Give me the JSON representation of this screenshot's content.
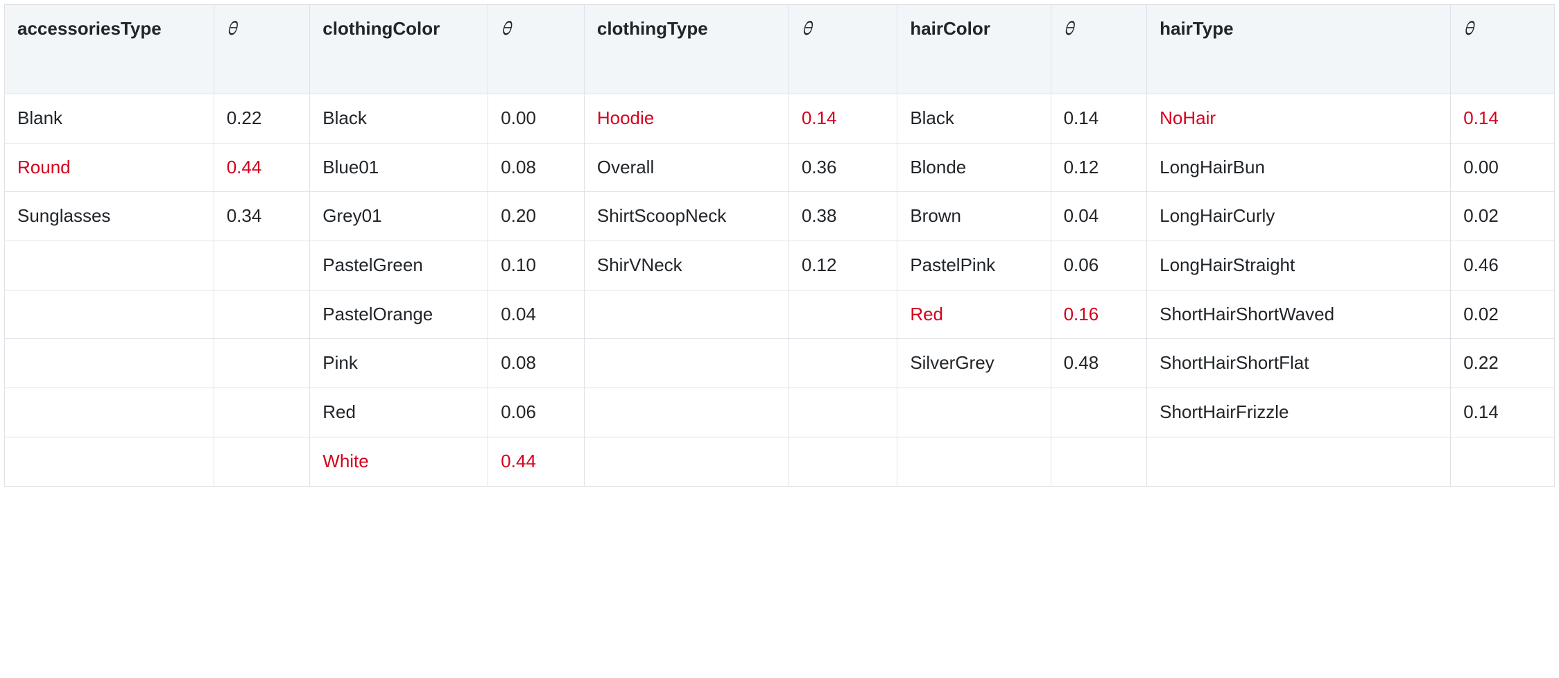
{
  "theta": "θ",
  "headers": [
    "accessoriesType",
    "θ",
    "clothingColor",
    "θ",
    "clothingType",
    "θ",
    "hairColor",
    "θ",
    "hairType",
    "θ"
  ],
  "headerIsTheta": [
    false,
    true,
    false,
    true,
    false,
    true,
    false,
    true,
    false,
    true
  ],
  "rows": [
    [
      {
        "t": "Blank",
        "hl": false
      },
      {
        "t": "0.22",
        "hl": false
      },
      {
        "t": "Black",
        "hl": false
      },
      {
        "t": "0.00",
        "hl": false
      },
      {
        "t": "Hoodie",
        "hl": true
      },
      {
        "t": "0.14",
        "hl": true
      },
      {
        "t": "Black",
        "hl": false
      },
      {
        "t": "0.14",
        "hl": false
      },
      {
        "t": "NoHair",
        "hl": true
      },
      {
        "t": "0.14",
        "hl": true
      }
    ],
    [
      {
        "t": "Round",
        "hl": true
      },
      {
        "t": "0.44",
        "hl": true
      },
      {
        "t": "Blue01",
        "hl": false
      },
      {
        "t": "0.08",
        "hl": false
      },
      {
        "t": "Overall",
        "hl": false
      },
      {
        "t": "0.36",
        "hl": false
      },
      {
        "t": "Blonde",
        "hl": false
      },
      {
        "t": "0.12",
        "hl": false
      },
      {
        "t": "LongHairBun",
        "hl": false
      },
      {
        "t": "0.00",
        "hl": false
      }
    ],
    [
      {
        "t": "Sunglasses",
        "hl": false
      },
      {
        "t": "0.34",
        "hl": false
      },
      {
        "t": "Grey01",
        "hl": false
      },
      {
        "t": "0.20",
        "hl": false
      },
      {
        "t": "ShirtScoopNeck",
        "hl": false
      },
      {
        "t": "0.38",
        "hl": false
      },
      {
        "t": "Brown",
        "hl": false
      },
      {
        "t": "0.04",
        "hl": false
      },
      {
        "t": "LongHairCurly",
        "hl": false
      },
      {
        "t": "0.02",
        "hl": false
      }
    ],
    [
      {
        "t": "",
        "hl": false
      },
      {
        "t": "",
        "hl": false
      },
      {
        "t": "PastelGreen",
        "hl": false
      },
      {
        "t": "0.10",
        "hl": false
      },
      {
        "t": "ShirVNeck",
        "hl": false
      },
      {
        "t": "0.12",
        "hl": false
      },
      {
        "t": "PastelPink",
        "hl": false
      },
      {
        "t": "0.06",
        "hl": false
      },
      {
        "t": "LongHairStraight",
        "hl": false
      },
      {
        "t": "0.46",
        "hl": false
      }
    ],
    [
      {
        "t": "",
        "hl": false
      },
      {
        "t": "",
        "hl": false
      },
      {
        "t": "PastelOrange",
        "hl": false
      },
      {
        "t": "0.04",
        "hl": false
      },
      {
        "t": "",
        "hl": false
      },
      {
        "t": "",
        "hl": false
      },
      {
        "t": "Red",
        "hl": true
      },
      {
        "t": "0.16",
        "hl": true
      },
      {
        "t": "ShortHairShortWaved",
        "hl": false
      },
      {
        "t": "0.02",
        "hl": false
      }
    ],
    [
      {
        "t": "",
        "hl": false
      },
      {
        "t": "",
        "hl": false
      },
      {
        "t": "Pink",
        "hl": false
      },
      {
        "t": "0.08",
        "hl": false
      },
      {
        "t": "",
        "hl": false
      },
      {
        "t": "",
        "hl": false
      },
      {
        "t": "SilverGrey",
        "hl": false
      },
      {
        "t": "0.48",
        "hl": false
      },
      {
        "t": "ShortHairShortFlat",
        "hl": false
      },
      {
        "t": "0.22",
        "hl": false
      }
    ],
    [
      {
        "t": "",
        "hl": false
      },
      {
        "t": "",
        "hl": false
      },
      {
        "t": "Red",
        "hl": false
      },
      {
        "t": "0.06",
        "hl": false
      },
      {
        "t": "",
        "hl": false
      },
      {
        "t": "",
        "hl": false
      },
      {
        "t": "",
        "hl": false
      },
      {
        "t": "",
        "hl": false
      },
      {
        "t": "ShortHairFrizzle",
        "hl": false
      },
      {
        "t": "0.14",
        "hl": false
      }
    ],
    [
      {
        "t": "",
        "hl": false
      },
      {
        "t": "",
        "hl": false
      },
      {
        "t": "White",
        "hl": true
      },
      {
        "t": "0.44",
        "hl": true
      },
      {
        "t": "",
        "hl": false
      },
      {
        "t": "",
        "hl": false
      },
      {
        "t": "",
        "hl": false
      },
      {
        "t": "",
        "hl": false
      },
      {
        "t": "",
        "hl": false
      },
      {
        "t": "",
        "hl": false
      }
    ]
  ]
}
